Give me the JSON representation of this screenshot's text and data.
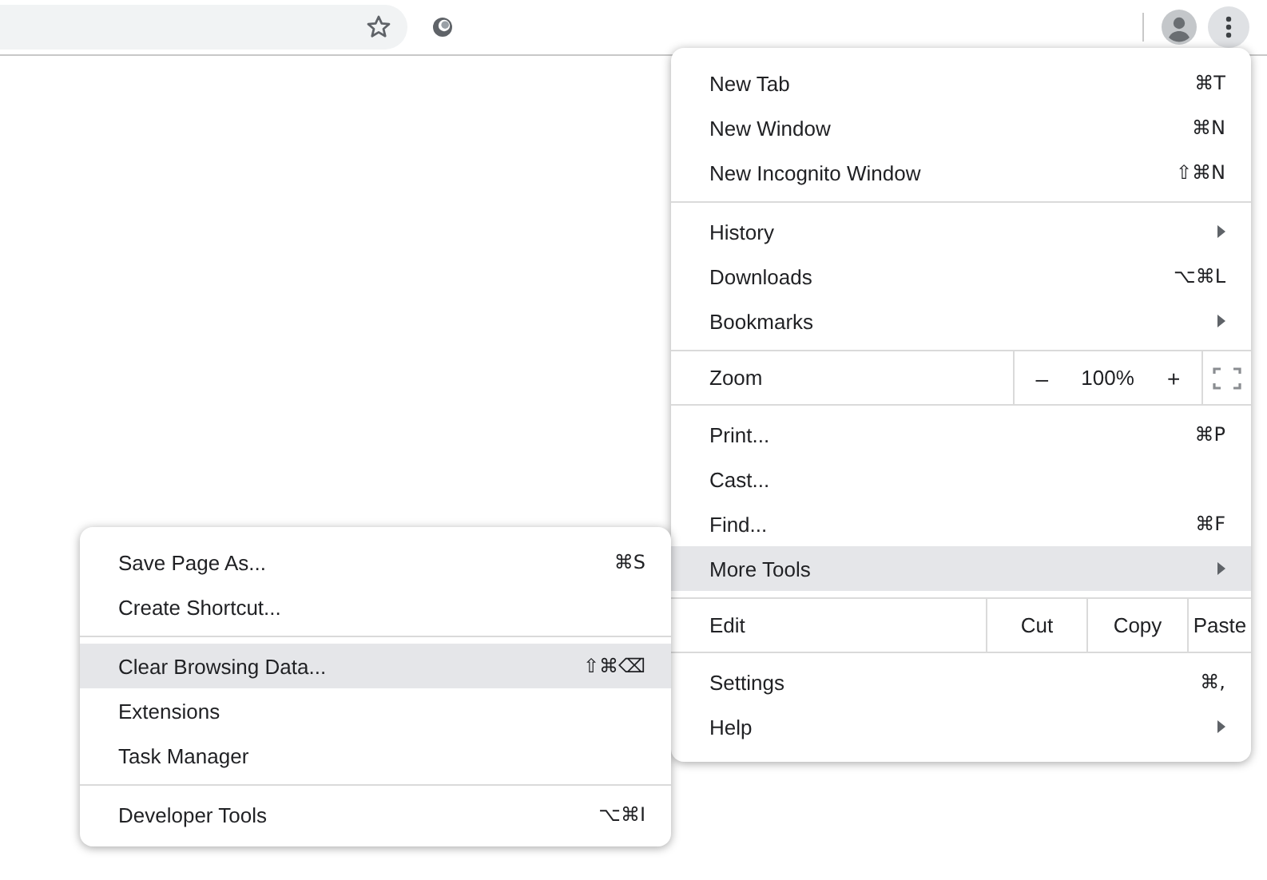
{
  "main_menu": {
    "sections": [
      [
        {
          "kind": "item",
          "label": "New Tab",
          "shortcut": "⌘T",
          "has_submenu": false,
          "selected": false
        },
        {
          "kind": "item",
          "label": "New Window",
          "shortcut": "⌘N",
          "has_submenu": false,
          "selected": false
        },
        {
          "kind": "item",
          "label": "New Incognito Window",
          "shortcut": "⇧⌘N",
          "has_submenu": false,
          "selected": false
        }
      ],
      [
        {
          "kind": "item",
          "label": "History",
          "has_submenu": true,
          "selected": false
        },
        {
          "kind": "item",
          "label": "Downloads",
          "shortcut": "⌥⌘L",
          "has_submenu": false,
          "selected": false
        },
        {
          "kind": "item",
          "label": "Bookmarks",
          "has_submenu": true,
          "selected": false
        }
      ],
      [
        {
          "kind": "zoom",
          "label": "Zoom",
          "minus": "–",
          "value": "100%",
          "plus": "+"
        }
      ],
      [
        {
          "kind": "item",
          "label": "Print...",
          "shortcut": "⌘P",
          "has_submenu": false,
          "selected": false
        },
        {
          "kind": "item",
          "label": "Cast...",
          "has_submenu": false,
          "selected": false
        },
        {
          "kind": "item",
          "label": "Find...",
          "shortcut": "⌘F",
          "has_submenu": false,
          "selected": false
        },
        {
          "kind": "item",
          "label": "More Tools",
          "has_submenu": true,
          "selected": true
        }
      ],
      [
        {
          "kind": "edit",
          "label": "Edit",
          "buttons": [
            "Cut",
            "Copy",
            "Paste"
          ]
        }
      ],
      [
        {
          "kind": "item",
          "label": "Settings",
          "shortcut": "⌘,",
          "has_submenu": false,
          "selected": false
        },
        {
          "kind": "item",
          "label": "Help",
          "has_submenu": true,
          "selected": false
        }
      ]
    ]
  },
  "submenu": {
    "sections": [
      [
        {
          "kind": "item",
          "label": "Save Page As...",
          "shortcut": "⌘S",
          "has_submenu": false,
          "selected": false
        },
        {
          "kind": "item",
          "label": "Create Shortcut...",
          "has_submenu": false,
          "selected": false
        }
      ],
      [
        {
          "kind": "item",
          "label": "Clear Browsing Data...",
          "shortcut": "⇧⌘⌫",
          "has_submenu": false,
          "selected": true
        },
        {
          "kind": "item",
          "label": "Extensions",
          "has_submenu": false,
          "selected": false
        },
        {
          "kind": "item",
          "label": "Task Manager",
          "has_submenu": false,
          "selected": false
        }
      ],
      [
        {
          "kind": "item",
          "label": "Developer Tools",
          "shortcut": "⌥⌘I",
          "has_submenu": false,
          "selected": false
        }
      ]
    ]
  }
}
